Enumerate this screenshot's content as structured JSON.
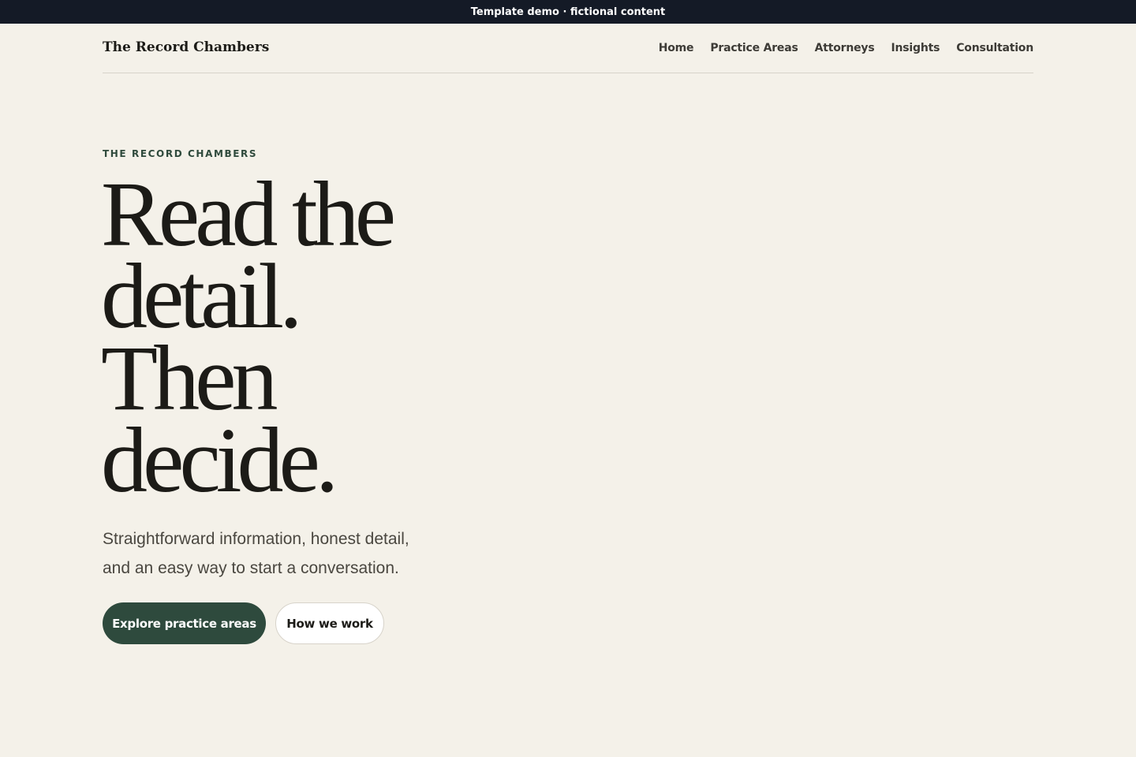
{
  "banner": {
    "text": "Template demo · fictional content"
  },
  "header": {
    "brand": "The Record Chambers",
    "nav": [
      {
        "label": "Home"
      },
      {
        "label": "Practice Areas"
      },
      {
        "label": "Attorneys"
      },
      {
        "label": "Insights"
      },
      {
        "label": "Consultation"
      }
    ]
  },
  "hero": {
    "eyebrow": "THE RECORD CHAMBERS",
    "headline_lines": [
      "Read the",
      "detail.",
      "Then",
      "decide."
    ],
    "subtext_lines": [
      "Straightforward information, honest detail,",
      "and an easy way to start a conversation."
    ],
    "primary_button": "Explore practice areas",
    "secondary_button": "How we work"
  },
  "colors": {
    "background": "#f4f1e9",
    "banner": "#141a26",
    "accent": "#2e4a3d"
  }
}
